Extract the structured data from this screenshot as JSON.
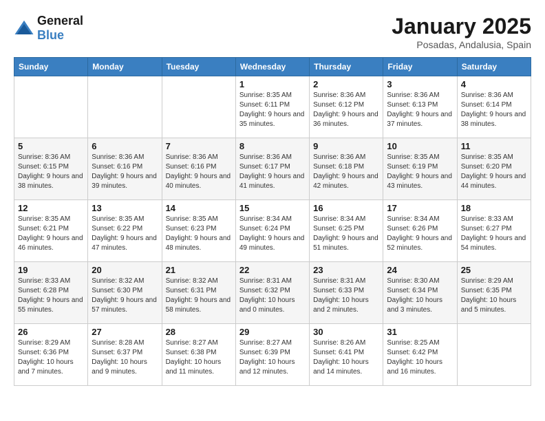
{
  "logo": {
    "line1": "General",
    "line2": "Blue"
  },
  "title": "January 2025",
  "subtitle": "Posadas, Andalusia, Spain",
  "days_header": [
    "Sunday",
    "Monday",
    "Tuesday",
    "Wednesday",
    "Thursday",
    "Friday",
    "Saturday"
  ],
  "weeks": [
    [
      {
        "day": "",
        "sunrise": "",
        "sunset": "",
        "daylight": ""
      },
      {
        "day": "",
        "sunrise": "",
        "sunset": "",
        "daylight": ""
      },
      {
        "day": "",
        "sunrise": "",
        "sunset": "",
        "daylight": ""
      },
      {
        "day": "1",
        "sunrise": "Sunrise: 8:35 AM",
        "sunset": "Sunset: 6:11 PM",
        "daylight": "Daylight: 9 hours and 35 minutes."
      },
      {
        "day": "2",
        "sunrise": "Sunrise: 8:36 AM",
        "sunset": "Sunset: 6:12 PM",
        "daylight": "Daylight: 9 hours and 36 minutes."
      },
      {
        "day": "3",
        "sunrise": "Sunrise: 8:36 AM",
        "sunset": "Sunset: 6:13 PM",
        "daylight": "Daylight: 9 hours and 37 minutes."
      },
      {
        "day": "4",
        "sunrise": "Sunrise: 8:36 AM",
        "sunset": "Sunset: 6:14 PM",
        "daylight": "Daylight: 9 hours and 38 minutes."
      }
    ],
    [
      {
        "day": "5",
        "sunrise": "Sunrise: 8:36 AM",
        "sunset": "Sunset: 6:15 PM",
        "daylight": "Daylight: 9 hours and 38 minutes."
      },
      {
        "day": "6",
        "sunrise": "Sunrise: 8:36 AM",
        "sunset": "Sunset: 6:16 PM",
        "daylight": "Daylight: 9 hours and 39 minutes."
      },
      {
        "day": "7",
        "sunrise": "Sunrise: 8:36 AM",
        "sunset": "Sunset: 6:16 PM",
        "daylight": "Daylight: 9 hours and 40 minutes."
      },
      {
        "day": "8",
        "sunrise": "Sunrise: 8:36 AM",
        "sunset": "Sunset: 6:17 PM",
        "daylight": "Daylight: 9 hours and 41 minutes."
      },
      {
        "day": "9",
        "sunrise": "Sunrise: 8:36 AM",
        "sunset": "Sunset: 6:18 PM",
        "daylight": "Daylight: 9 hours and 42 minutes."
      },
      {
        "day": "10",
        "sunrise": "Sunrise: 8:35 AM",
        "sunset": "Sunset: 6:19 PM",
        "daylight": "Daylight: 9 hours and 43 minutes."
      },
      {
        "day": "11",
        "sunrise": "Sunrise: 8:35 AM",
        "sunset": "Sunset: 6:20 PM",
        "daylight": "Daylight: 9 hours and 44 minutes."
      }
    ],
    [
      {
        "day": "12",
        "sunrise": "Sunrise: 8:35 AM",
        "sunset": "Sunset: 6:21 PM",
        "daylight": "Daylight: 9 hours and 46 minutes."
      },
      {
        "day": "13",
        "sunrise": "Sunrise: 8:35 AM",
        "sunset": "Sunset: 6:22 PM",
        "daylight": "Daylight: 9 hours and 47 minutes."
      },
      {
        "day": "14",
        "sunrise": "Sunrise: 8:35 AM",
        "sunset": "Sunset: 6:23 PM",
        "daylight": "Daylight: 9 hours and 48 minutes."
      },
      {
        "day": "15",
        "sunrise": "Sunrise: 8:34 AM",
        "sunset": "Sunset: 6:24 PM",
        "daylight": "Daylight: 9 hours and 49 minutes."
      },
      {
        "day": "16",
        "sunrise": "Sunrise: 8:34 AM",
        "sunset": "Sunset: 6:25 PM",
        "daylight": "Daylight: 9 hours and 51 minutes."
      },
      {
        "day": "17",
        "sunrise": "Sunrise: 8:34 AM",
        "sunset": "Sunset: 6:26 PM",
        "daylight": "Daylight: 9 hours and 52 minutes."
      },
      {
        "day": "18",
        "sunrise": "Sunrise: 8:33 AM",
        "sunset": "Sunset: 6:27 PM",
        "daylight": "Daylight: 9 hours and 54 minutes."
      }
    ],
    [
      {
        "day": "19",
        "sunrise": "Sunrise: 8:33 AM",
        "sunset": "Sunset: 6:28 PM",
        "daylight": "Daylight: 9 hours and 55 minutes."
      },
      {
        "day": "20",
        "sunrise": "Sunrise: 8:32 AM",
        "sunset": "Sunset: 6:30 PM",
        "daylight": "Daylight: 9 hours and 57 minutes."
      },
      {
        "day": "21",
        "sunrise": "Sunrise: 8:32 AM",
        "sunset": "Sunset: 6:31 PM",
        "daylight": "Daylight: 9 hours and 58 minutes."
      },
      {
        "day": "22",
        "sunrise": "Sunrise: 8:31 AM",
        "sunset": "Sunset: 6:32 PM",
        "daylight": "Daylight: 10 hours and 0 minutes."
      },
      {
        "day": "23",
        "sunrise": "Sunrise: 8:31 AM",
        "sunset": "Sunset: 6:33 PM",
        "daylight": "Daylight: 10 hours and 2 minutes."
      },
      {
        "day": "24",
        "sunrise": "Sunrise: 8:30 AM",
        "sunset": "Sunset: 6:34 PM",
        "daylight": "Daylight: 10 hours and 3 minutes."
      },
      {
        "day": "25",
        "sunrise": "Sunrise: 8:29 AM",
        "sunset": "Sunset: 6:35 PM",
        "daylight": "Daylight: 10 hours and 5 minutes."
      }
    ],
    [
      {
        "day": "26",
        "sunrise": "Sunrise: 8:29 AM",
        "sunset": "Sunset: 6:36 PM",
        "daylight": "Daylight: 10 hours and 7 minutes."
      },
      {
        "day": "27",
        "sunrise": "Sunrise: 8:28 AM",
        "sunset": "Sunset: 6:37 PM",
        "daylight": "Daylight: 10 hours and 9 minutes."
      },
      {
        "day": "28",
        "sunrise": "Sunrise: 8:27 AM",
        "sunset": "Sunset: 6:38 PM",
        "daylight": "Daylight: 10 hours and 11 minutes."
      },
      {
        "day": "29",
        "sunrise": "Sunrise: 8:27 AM",
        "sunset": "Sunset: 6:39 PM",
        "daylight": "Daylight: 10 hours and 12 minutes."
      },
      {
        "day": "30",
        "sunrise": "Sunrise: 8:26 AM",
        "sunset": "Sunset: 6:41 PM",
        "daylight": "Daylight: 10 hours and 14 minutes."
      },
      {
        "day": "31",
        "sunrise": "Sunrise: 8:25 AM",
        "sunset": "Sunset: 6:42 PM",
        "daylight": "Daylight: 10 hours and 16 minutes."
      },
      {
        "day": "",
        "sunrise": "",
        "sunset": "",
        "daylight": ""
      }
    ]
  ]
}
